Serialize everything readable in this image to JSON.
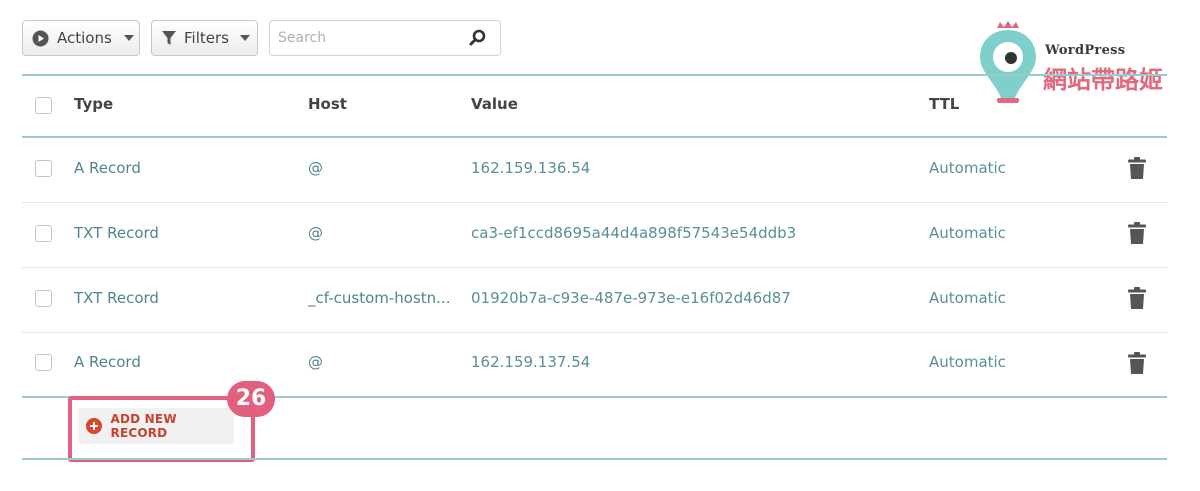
{
  "toolbar": {
    "actions_label": "Actions",
    "filters_label": "Filters",
    "search_placeholder": "Search"
  },
  "logo": {
    "brand_top": "WordPress",
    "brand_bottom": "網站帶路姬",
    "accent_color": "#e2687e",
    "pin_color": "#7fcfca"
  },
  "table": {
    "columns": [
      "Type",
      "Host",
      "Value",
      "TTL"
    ],
    "rows": [
      {
        "type": "A Record",
        "host": "@",
        "value": "162.159.136.54",
        "ttl": "Automatic"
      },
      {
        "type": "TXT Record",
        "host": "@",
        "value": "ca3-ef1ccd8695a44d4a898f57543e54ddb3",
        "ttl": "Automatic"
      },
      {
        "type": "TXT Record",
        "host": "_cf-custom-hostn...",
        "value": "01920b7a-c93e-487e-973e-e16f02d46d87",
        "ttl": "Automatic"
      },
      {
        "type": "A Record",
        "host": "@",
        "value": "162.159.137.54",
        "ttl": "Automatic"
      }
    ]
  },
  "add_record": {
    "label": "ADD NEW RECORD",
    "step_badge": "26",
    "highlight_color": "#e2607d"
  }
}
